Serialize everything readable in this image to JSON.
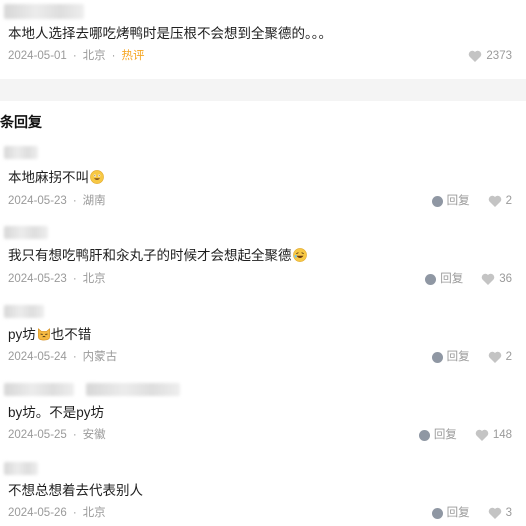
{
  "top_comment": {
    "text": "本地人选择去哪吃烤鸭时是压根不会想到全聚德的。。。",
    "date": "2024-05-01",
    "location": "北京",
    "hot_badge": "热评",
    "likes": "2373"
  },
  "section": {
    "title": "条回复"
  },
  "separator": "·",
  "reply_label": "回复",
  "replies": [
    {
      "text": "本地麻拐不叫",
      "emoji": "grinning-face",
      "date": "2024-05-23",
      "location": "湖南",
      "likes": "2"
    },
    {
      "text": "我只有想吃鸭肝和汆丸子的时候才会想起全聚德",
      "emoji": "laughing-face",
      "date": "2024-05-23",
      "location": "北京",
      "likes": "36"
    },
    {
      "text_before": "py坊",
      "emoji": "cat-face",
      "text_after": "也不错",
      "date": "2024-05-24",
      "location": "内蒙古",
      "likes": "2"
    },
    {
      "text": "by坊。不是py坊",
      "date": "2024-05-25",
      "location": "安徽",
      "likes": "148"
    },
    {
      "text": "不想总想着去代表别人",
      "date": "2024-05-26",
      "location": "北京",
      "likes": "3"
    }
  ],
  "colors": {
    "meta_gray": "#9a9a9a",
    "hot_orange": "#f5a623",
    "divider_bg": "#f4f4f4",
    "bubble_icon": "#8f97a3"
  }
}
